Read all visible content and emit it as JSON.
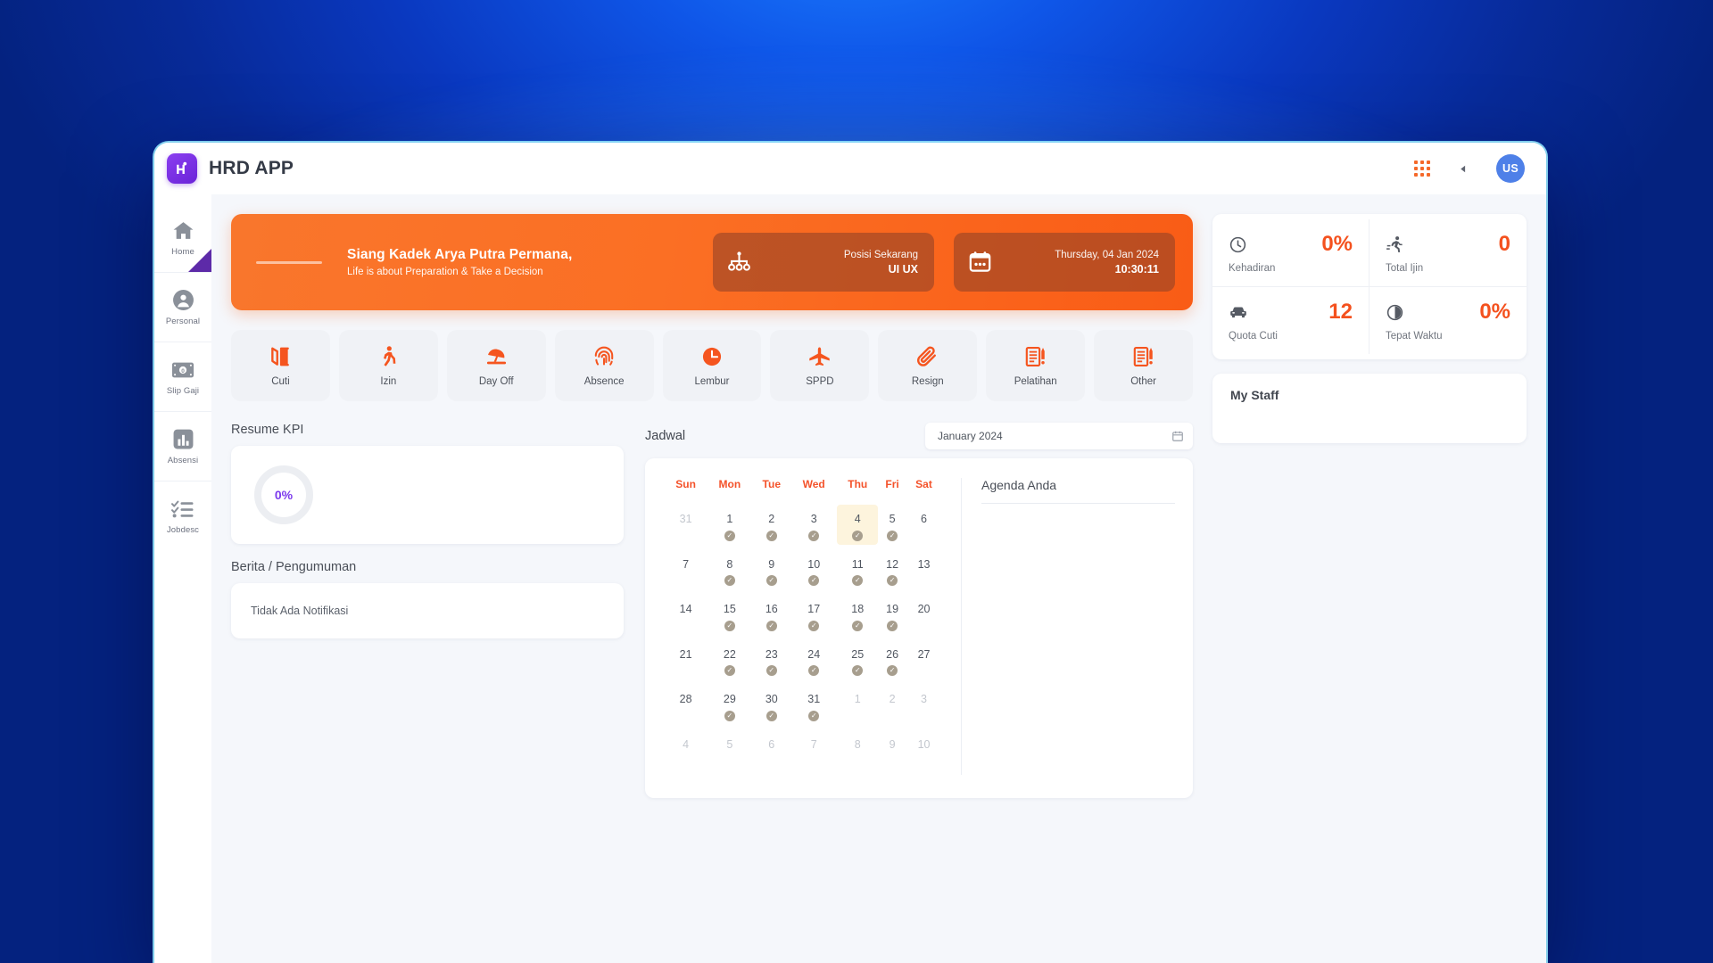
{
  "header": {
    "app_title": "HRD APP",
    "logo_icon": "hrd-logo-icon",
    "grid_icon": "apps-grid-icon",
    "back_icon": "chevron-left-icon",
    "avatar_initials": "US"
  },
  "sidebar": {
    "items": [
      {
        "label": "Home",
        "icon": "home-icon",
        "active": true
      },
      {
        "label": "Personal",
        "icon": "user-circle-icon",
        "active": false
      },
      {
        "label": "Slip Gaji",
        "icon": "money-bill-icon",
        "active": false
      },
      {
        "label": "Absensi",
        "icon": "bar-chart-icon",
        "active": false
      },
      {
        "label": "Jobdesc",
        "icon": "checklist-icon",
        "active": false
      }
    ]
  },
  "hero": {
    "greeting": "Siang Kadek Arya Putra Permana,",
    "tagline": "Life is about Preparation & Take a Decision",
    "cards": [
      {
        "icon": "org-chart-icon",
        "line1": "Posisi Sekarang",
        "line2": "UI UX"
      },
      {
        "icon": "calendar-icon",
        "line1": "Thursday, 04 Jan 2024",
        "line2": "10:30:11"
      }
    ]
  },
  "quick_actions": [
    {
      "label": "Cuti",
      "icon": "open-door-icon"
    },
    {
      "label": "Izin",
      "icon": "walking-person-icon"
    },
    {
      "label": "Day Off",
      "icon": "beach-umbrella-icon"
    },
    {
      "label": "Absence",
      "icon": "fingerprint-icon"
    },
    {
      "label": "Lembur",
      "icon": "clock-filled-icon"
    },
    {
      "label": "SPPD",
      "icon": "airplane-icon"
    },
    {
      "label": "Resign",
      "icon": "paperclip-icon"
    },
    {
      "label": "Pelatihan",
      "icon": "document-pen-icon"
    },
    {
      "label": "Other",
      "icon": "document-pen-icon"
    }
  ],
  "kpi": {
    "section_title": "Resume KPI",
    "percent": "0%"
  },
  "news": {
    "section_title": "Berita / Pengumuman",
    "empty_text": "Tidak Ada Notifikasi"
  },
  "jadwal": {
    "title": "Jadwal",
    "month_value": "January 2024",
    "calendar_icon": "calendar-picker-icon",
    "weekdays": [
      "Sun",
      "Mon",
      "Tue",
      "Wed",
      "Thu",
      "Fri",
      "Sat"
    ],
    "weeks": [
      [
        {
          "d": "31",
          "muted": true,
          "check": false,
          "today": false
        },
        {
          "d": "1",
          "muted": false,
          "check": true,
          "today": false
        },
        {
          "d": "2",
          "muted": false,
          "check": true,
          "today": false
        },
        {
          "d": "3",
          "muted": false,
          "check": true,
          "today": false
        },
        {
          "d": "4",
          "muted": false,
          "check": true,
          "today": true
        },
        {
          "d": "5",
          "muted": false,
          "check": true,
          "today": false
        },
        {
          "d": "6",
          "muted": false,
          "check": false,
          "today": false
        }
      ],
      [
        {
          "d": "7",
          "muted": false,
          "check": false,
          "today": false
        },
        {
          "d": "8",
          "muted": false,
          "check": true,
          "today": false
        },
        {
          "d": "9",
          "muted": false,
          "check": true,
          "today": false
        },
        {
          "d": "10",
          "muted": false,
          "check": true,
          "today": false
        },
        {
          "d": "11",
          "muted": false,
          "check": true,
          "today": false
        },
        {
          "d": "12",
          "muted": false,
          "check": true,
          "today": false
        },
        {
          "d": "13",
          "muted": false,
          "check": false,
          "today": false
        }
      ],
      [
        {
          "d": "14",
          "muted": false,
          "check": false,
          "today": false
        },
        {
          "d": "15",
          "muted": false,
          "check": true,
          "today": false
        },
        {
          "d": "16",
          "muted": false,
          "check": true,
          "today": false
        },
        {
          "d": "17",
          "muted": false,
          "check": true,
          "today": false
        },
        {
          "d": "18",
          "muted": false,
          "check": true,
          "today": false
        },
        {
          "d": "19",
          "muted": false,
          "check": true,
          "today": false
        },
        {
          "d": "20",
          "muted": false,
          "check": false,
          "today": false
        }
      ],
      [
        {
          "d": "21",
          "muted": false,
          "check": false,
          "today": false
        },
        {
          "d": "22",
          "muted": false,
          "check": true,
          "today": false
        },
        {
          "d": "23",
          "muted": false,
          "check": true,
          "today": false
        },
        {
          "d": "24",
          "muted": false,
          "check": true,
          "today": false
        },
        {
          "d": "25",
          "muted": false,
          "check": true,
          "today": false
        },
        {
          "d": "26",
          "muted": false,
          "check": true,
          "today": false
        },
        {
          "d": "27",
          "muted": false,
          "check": false,
          "today": false
        }
      ],
      [
        {
          "d": "28",
          "muted": false,
          "check": false,
          "today": false
        },
        {
          "d": "29",
          "muted": false,
          "check": true,
          "today": false
        },
        {
          "d": "30",
          "muted": false,
          "check": true,
          "today": false
        },
        {
          "d": "31",
          "muted": false,
          "check": true,
          "today": false
        },
        {
          "d": "1",
          "muted": true,
          "check": false,
          "today": false
        },
        {
          "d": "2",
          "muted": true,
          "check": false,
          "today": false
        },
        {
          "d": "3",
          "muted": true,
          "check": false,
          "today": false
        }
      ],
      [
        {
          "d": "4",
          "muted": true,
          "check": false,
          "today": false
        },
        {
          "d": "5",
          "muted": true,
          "check": false,
          "today": false
        },
        {
          "d": "6",
          "muted": true,
          "check": false,
          "today": false
        },
        {
          "d": "7",
          "muted": true,
          "check": false,
          "today": false
        },
        {
          "d": "8",
          "muted": true,
          "check": false,
          "today": false
        },
        {
          "d": "9",
          "muted": true,
          "check": false,
          "today": false
        },
        {
          "d": "10",
          "muted": true,
          "check": false,
          "today": false
        }
      ]
    ],
    "agenda_title": "Agenda Anda"
  },
  "stats": [
    {
      "icon": "clock-outline-icon",
      "value": "0%",
      "label": "Kehadiran"
    },
    {
      "icon": "running-person-icon",
      "value": "0",
      "label": "Total Ijin"
    },
    {
      "icon": "car-icon",
      "value": "12",
      "label": "Quota Cuti"
    },
    {
      "icon": "half-moon-clock-icon",
      "value": "0%",
      "label": "Tepat Waktu"
    }
  ],
  "my_staff": {
    "title": "My Staff"
  },
  "colors": {
    "accent_orange": "#f4511e",
    "hero_orange": "#fb6f24",
    "brand_purple": "#6a23d8",
    "kpi_purple": "#7c3aed",
    "avatar_blue": "#4e80e8",
    "today_highlight": "#fdf4dd"
  }
}
